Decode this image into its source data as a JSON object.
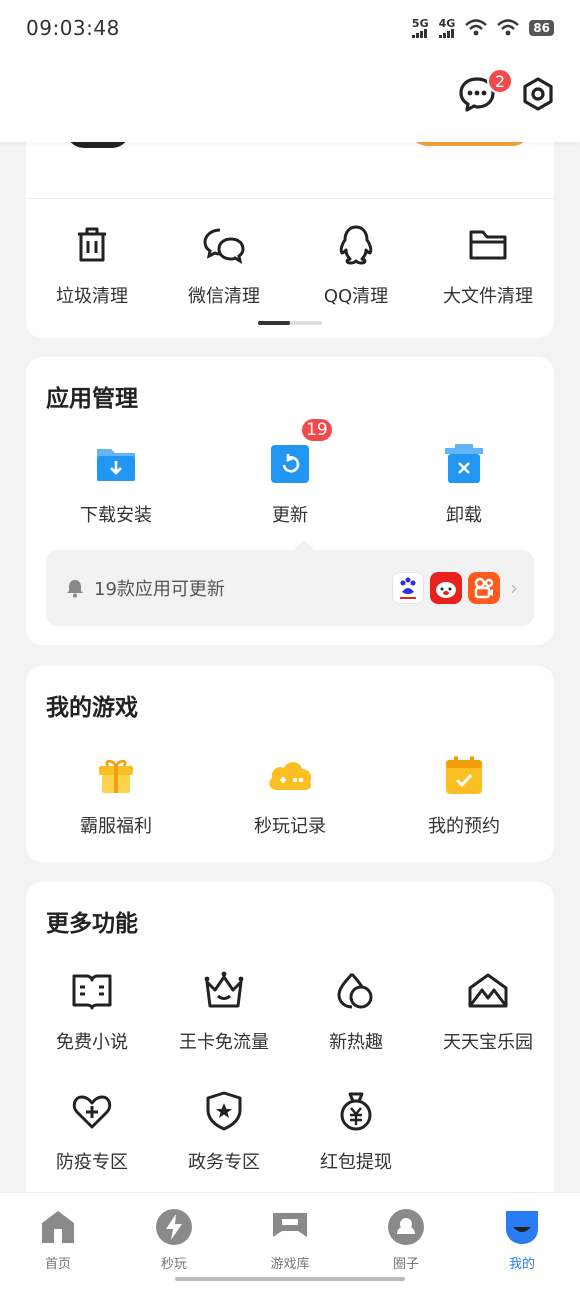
{
  "status_bar": {
    "time": "09:03:48",
    "net1": "5G",
    "net2": "4G",
    "battery": "86"
  },
  "header": {
    "message_badge": "2"
  },
  "clean": {
    "items": [
      {
        "label": "垃圾清理",
        "icon": "trash-icon"
      },
      {
        "label": "微信清理",
        "icon": "wechat-icon"
      },
      {
        "label": "QQ清理",
        "icon": "qq-icon"
      },
      {
        "label": "大文件清理",
        "icon": "folder-icon"
      }
    ]
  },
  "apps": {
    "title": "应用管理",
    "items": [
      {
        "label": "下载安装",
        "icon": "download-folder-icon"
      },
      {
        "label": "更新",
        "icon": "update-icon",
        "badge": "19"
      },
      {
        "label": "卸载",
        "icon": "uninstall-icon"
      }
    ],
    "update_text": "19款应用可更新",
    "app_thumbs": [
      "baidu-app-icon",
      "jd-app-icon",
      "kuaishou-app-icon"
    ],
    "colors": {
      "blue": "#2196f3",
      "red": "#e8231f",
      "orange": "#ff5a1f"
    }
  },
  "games": {
    "title": "我的游戏",
    "items": [
      {
        "label": "霸服福利",
        "icon": "gift-icon"
      },
      {
        "label": "秒玩记录",
        "icon": "cloud-game-icon"
      },
      {
        "label": "我的预约",
        "icon": "calendar-check-icon"
      }
    ],
    "color": "#fbbf24"
  },
  "more": {
    "title": "更多功能",
    "items": [
      {
        "label": "免费小说",
        "icon": "book-icon"
      },
      {
        "label": "王卡免流量",
        "icon": "crown-icon"
      },
      {
        "label": "新热趣",
        "icon": "drops-icon"
      },
      {
        "label": "天天宝乐园",
        "icon": "tent-icon"
      },
      {
        "label": "防疫专区",
        "icon": "heart-plus-icon"
      },
      {
        "label": "政务专区",
        "icon": "shield-star-icon"
      },
      {
        "label": "红包提现",
        "icon": "money-bag-icon"
      }
    ]
  },
  "nav": {
    "items": [
      {
        "label": "首页",
        "icon": "home-icon"
      },
      {
        "label": "秒玩",
        "icon": "flash-icon"
      },
      {
        "label": "游戏库",
        "icon": "game-library-icon"
      },
      {
        "label": "圈子",
        "icon": "circle-icon"
      },
      {
        "label": "我的",
        "icon": "profile-icon"
      }
    ],
    "active": "我的",
    "active_color": "#2a7cf2"
  }
}
